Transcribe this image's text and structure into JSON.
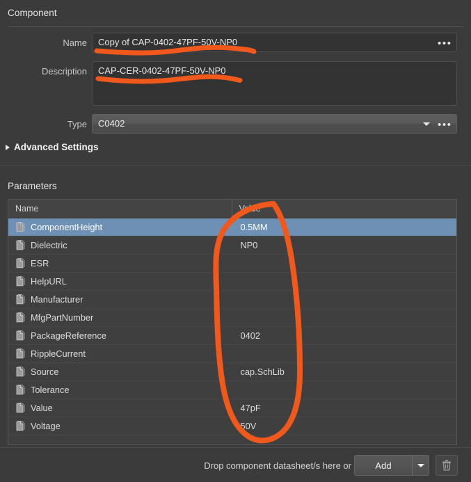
{
  "section": {
    "component_title": "Component",
    "advanced_settings_label": "Advanced Settings",
    "parameters_title": "Parameters"
  },
  "fields": {
    "name_label": "Name",
    "name_value": "Copy of CAP-0402-47PF-50V-NP0",
    "description_label": "Description",
    "description_value": "CAP-CER-0402-47PF-50V-NP0",
    "type_label": "Type",
    "type_value": "C0402",
    "ellipsis_label": "•••"
  },
  "table": {
    "columns": [
      "Name",
      "Value"
    ],
    "rows": [
      {
        "name": "ComponentHeight",
        "value": "0.5MM",
        "selected": true
      },
      {
        "name": "Dielectric",
        "value": "NP0",
        "selected": false
      },
      {
        "name": "ESR",
        "value": "",
        "selected": false
      },
      {
        "name": "HelpURL",
        "value": "",
        "selected": false
      },
      {
        "name": "Manufacturer",
        "value": "",
        "selected": false
      },
      {
        "name": "MfgPartNumber",
        "value": "",
        "selected": false
      },
      {
        "name": "PackageReference",
        "value": "0402",
        "selected": false
      },
      {
        "name": "RippleCurrent",
        "value": "",
        "selected": false
      },
      {
        "name": "Source",
        "value": "cap.SchLib",
        "selected": false
      },
      {
        "name": "Tolerance",
        "value": "",
        "selected": false
      },
      {
        "name": "Value",
        "value": "47pF",
        "selected": false
      },
      {
        "name": "Voltage",
        "value": "50V",
        "selected": false
      }
    ]
  },
  "footer": {
    "drop_text": "Drop component datasheet/s here or",
    "add_label": "Add"
  },
  "icons": {
    "row": "document-icon",
    "delete": "trash-icon",
    "dropdown": "chevron-down-icon",
    "expander": "triangle-right-icon"
  },
  "colors": {
    "accent_annotation": "#F1581C",
    "selection": "#6D90B4",
    "panel_bg": "#3B3B3B",
    "field_bg": "#333333",
    "table_bg": "#3F3F3F"
  },
  "annotations": {
    "name_underline": "hand-drawn orange underline beneath Name field text",
    "description_underline": "hand-drawn orange underline beneath Description field text",
    "value_column_circle": "hand-drawn orange ellipse around the Value column"
  }
}
